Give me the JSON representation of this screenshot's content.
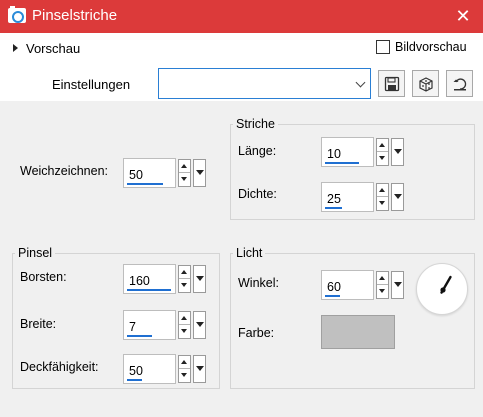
{
  "window": {
    "title": "Pinselstriche",
    "close_glyph": "✕"
  },
  "preview": {
    "toggle_label": "Vorschau",
    "bildvorschau_label": "Bildvorschau",
    "bildvorschau_checked": false
  },
  "settings": {
    "label": "Einstellungen",
    "selected_preset": "",
    "buttons": [
      {
        "name": "save-preset-button",
        "icon": "floppy-disk-icon"
      },
      {
        "name": "random-preset-button",
        "icon": "dice-icon"
      },
      {
        "name": "reset-preset-button",
        "icon": "reset-icon"
      }
    ]
  },
  "weichzeichnen": {
    "label": "Weichzeichnen:",
    "value": "50",
    "bar_fraction": 0.77
  },
  "striche": {
    "title": "Striche",
    "laenge": {
      "label": "Länge:",
      "value": "10",
      "bar_fraction": 0.72
    },
    "dichte": {
      "label": "Dichte:",
      "value": "25",
      "bar_fraction": 0.36
    }
  },
  "pinsel": {
    "title": "Pinsel",
    "borsten": {
      "label": "Borsten:",
      "value": "160",
      "bar_fraction": 0.94
    },
    "breite": {
      "label": "Breite:",
      "value": "7",
      "bar_fraction": 0.53
    },
    "deckfaehigkeit": {
      "label": "Deckfähigkeit:",
      "value": "50",
      "bar_fraction": 0.32
    }
  },
  "licht": {
    "title": "Licht",
    "winkel": {
      "label": "Winkel:",
      "value": "60",
      "bar_fraction": 0.32,
      "dial_angle_deg": 60
    },
    "farbe": {
      "label": "Farbe:",
      "color": "#c0c0c0"
    }
  },
  "colors": {
    "titlebar": "#dc3a3a",
    "accent": "#1f6fd1"
  }
}
